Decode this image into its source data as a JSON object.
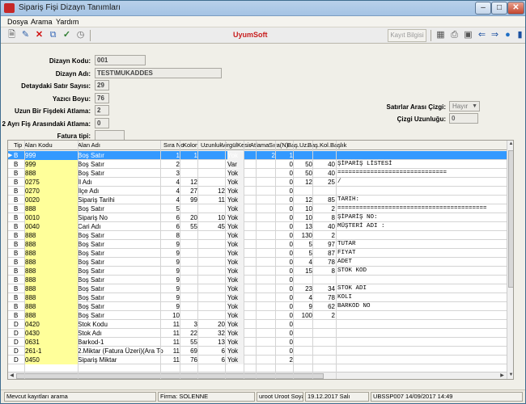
{
  "window": {
    "title": "Sipariş Fişi Dizayn Tanımları"
  },
  "menu": [
    "Dosya",
    "Arama",
    "Yardım"
  ],
  "toolbar": {
    "brand": "UyumSoft",
    "kayit": "Kayıt Bilgisi"
  },
  "form": {
    "dizayn_kodu": {
      "label": "Dizayn Kodu:",
      "value": "001"
    },
    "dizayn_adi": {
      "label": "Dizayn Adı:",
      "value": "TEST\\MUKADDES"
    },
    "detay_satir": {
      "label": "Detaydaki Satır Sayısı:",
      "value": "29"
    },
    "yazici_boyu": {
      "label": "Yazıcı Boyu:",
      "value": "76"
    },
    "uzun_fis": {
      "label": "Uzun Bir Fişdeki Atlama:",
      "value": "2"
    },
    "ayri_fis": {
      "label": "2 Ayrı Fiş Arasındaki Atlama:",
      "value": "0"
    },
    "fatura_tipi": {
      "label": "Fatura tipi:",
      "value": ""
    },
    "satir_cizgi": {
      "label": "Satırlar Arası Çizgi:",
      "value": "Hayır"
    },
    "cizgi_uzunlugu": {
      "label": "Çizgi Uzunluğu:",
      "value": "0"
    }
  },
  "grid": {
    "headers": [
      "Tip",
      "Alan Kodu",
      "Alan Adı",
      "Sıra No",
      "Kolon",
      "Uzunluk",
      "Virgül",
      "Kesir",
      "Atlama",
      "Sıra(N)",
      "Baş.Uz.",
      "Baş.Kol.",
      "Başlık"
    ],
    "rows": [
      [
        "B",
        "999",
        "Boş Satır",
        "1",
        "1",
        "",
        "Yok",
        "",
        "2",
        "1",
        "",
        "",
        ""
      ],
      [
        "B",
        "999",
        "Boş Satır",
        "2",
        "",
        "",
        "Var",
        "",
        "",
        "0",
        "50",
        "40",
        "ŞİPARİŞ LİSTESİ"
      ],
      [
        "B",
        "888",
        "Boş Satır",
        "3",
        "",
        "",
        "Yok",
        "",
        "",
        "0",
        "50",
        "40",
        "=============================="
      ],
      [
        "B",
        "0275",
        "İl Adı",
        "4",
        "12",
        "",
        "Yok",
        "",
        "",
        "0",
        "12",
        "25",
        "/"
      ],
      [
        "B",
        "0270",
        "İlçe Adı",
        "4",
        "27",
        "12",
        "Yok",
        "",
        "",
        "0",
        "",
        "",
        ""
      ],
      [
        "B",
        "0020",
        "Sipariş Tarihi",
        "4",
        "99",
        "11",
        "Yok",
        "",
        "",
        "0",
        "12",
        "85",
        "TARIH:"
      ],
      [
        "B",
        "888",
        "Boş Satır",
        "5",
        "",
        "",
        "Yok",
        "",
        "",
        "0",
        "10",
        "2",
        "========================================="
      ],
      [
        "B",
        "0010",
        "Sipariş No",
        "6",
        "20",
        "10",
        "Yok",
        "",
        "",
        "0",
        "10",
        "8",
        "ŞİPARİŞ NO:"
      ],
      [
        "B",
        "0040",
        "Cari Adı",
        "6",
        "55",
        "45",
        "Yok",
        "",
        "",
        "0",
        "13",
        "40",
        "MÜŞTERİ ADI :"
      ],
      [
        "B",
        "888",
        "Boş Satır",
        "8",
        "",
        "",
        "Yok",
        "",
        "",
        "0",
        "130",
        "2",
        ""
      ],
      [
        "B",
        "888",
        "Boş Satır",
        "9",
        "",
        "",
        "Yok",
        "",
        "",
        "0",
        "5",
        "97",
        "TUTAR"
      ],
      [
        "B",
        "888",
        "Boş Satır",
        "9",
        "",
        "",
        "Yok",
        "",
        "",
        "0",
        "5",
        "87",
        "FIYAT"
      ],
      [
        "B",
        "888",
        "Boş Satır",
        "9",
        "",
        "",
        "Yok",
        "",
        "",
        "0",
        "4",
        "78",
        "ADET"
      ],
      [
        "B",
        "888",
        "Boş Satır",
        "9",
        "",
        "",
        "Yok",
        "",
        "",
        "0",
        "15",
        "8",
        "STOK KOD"
      ],
      [
        "B",
        "888",
        "Boş Satır",
        "9",
        "",
        "",
        "Yok",
        "",
        "",
        "0",
        "",
        "",
        ""
      ],
      [
        "B",
        "888",
        "Boş Satır",
        "9",
        "",
        "",
        "Yok",
        "",
        "",
        "0",
        "23",
        "34",
        "STOK ADI"
      ],
      [
        "B",
        "888",
        "Boş Satır",
        "9",
        "",
        "",
        "Yok",
        "",
        "",
        "0",
        "4",
        "78",
        "KOLI"
      ],
      [
        "B",
        "888",
        "Boş Satır",
        "9",
        "",
        "",
        "Yok",
        "",
        "",
        "0",
        "9",
        "62",
        "BARKOD NO"
      ],
      [
        "B",
        "888",
        "Boş Satır",
        "10",
        "",
        "",
        "Yok",
        "",
        "",
        "0",
        "100",
        "2",
        ""
      ],
      [
        "D",
        "0420",
        "Stok Kodu",
        "11",
        "3",
        "20",
        "Yok",
        "",
        "",
        "0",
        "",
        "",
        ""
      ],
      [
        "D",
        "0430",
        "Stok Adı",
        "11",
        "22",
        "32",
        "Yok",
        "",
        "",
        "0",
        "",
        "",
        ""
      ],
      [
        "D",
        "0631",
        "Barkod-1",
        "11",
        "55",
        "13",
        "Yok",
        "",
        "",
        "0",
        "",
        "",
        ""
      ],
      [
        "D",
        "261-1",
        "2.Miktar (Fatura Üzeri)(Ara To",
        "11",
        "69",
        "6",
        "Yok",
        "",
        "",
        "0",
        "",
        "",
        ""
      ],
      [
        "D",
        "0450",
        "Sipariş Miktar",
        "11",
        "76",
        "6",
        "Yok",
        "",
        "",
        "2",
        "",
        "",
        ""
      ]
    ]
  },
  "status": [
    "Mevcut kayıtları arama",
    "Firma: SOLENNE",
    "uroot Uroot Soyadı",
    "19.12.2017 Salı",
    "UBSSP007 14/09/2017 14:49"
  ]
}
